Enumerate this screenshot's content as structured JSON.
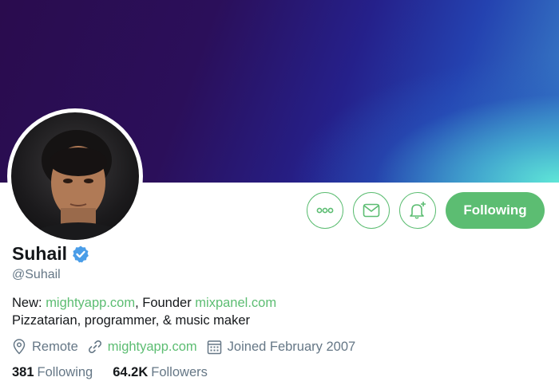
{
  "profile": {
    "name": "Suhail",
    "handle": "@Suhail",
    "verified": true,
    "bio_line1_prefix": "New: ",
    "bio_line1_link1": "mightyapp.com",
    "bio_line1_middle": ", Founder ",
    "bio_line1_link2": "mixpanel.com",
    "bio_line2": "Pizzatarian, programmer, & music maker",
    "location": "Remote",
    "website": "mightyapp.com",
    "joined": "Joined February 2007",
    "following_count": "381",
    "following_label": "Following",
    "followers_count": "64.2K",
    "followers_label": "Followers"
  },
  "actions": {
    "more_icon": "more-horizontal-icon",
    "message_icon": "envelope-icon",
    "notify_icon": "bell-plus-icon",
    "follow_label": "Following"
  },
  "colors": {
    "accent": "#5cbd72",
    "verified": "#4a9de8",
    "secondary_text": "#657786"
  }
}
